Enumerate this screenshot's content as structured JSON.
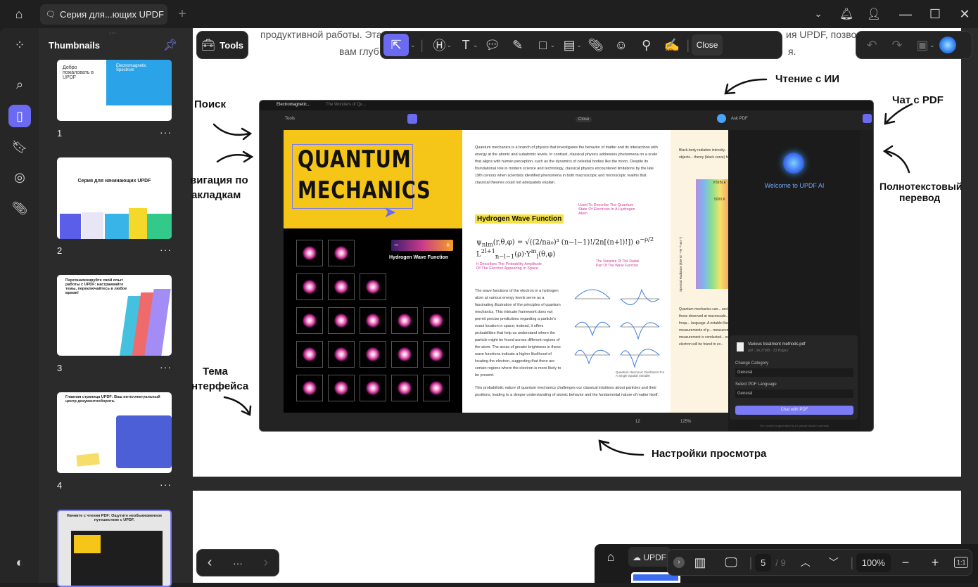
{
  "window": {
    "tab_title": "Серия для...ющих UPDF",
    "new_tab": "+"
  },
  "window_controls": [
    "chevron-down",
    "bell",
    "user",
    "minimize",
    "maximize",
    "close"
  ],
  "rail": {
    "items": [
      "thumbnails-grid",
      "search",
      "pages",
      "bookmarks",
      "ai-chat",
      "attachments"
    ],
    "bottom": "theme"
  },
  "thumbnails": {
    "title": "Thumbnails",
    "pages": [
      {
        "num": "1",
        "heading": "Добро пожаловать в UPDF",
        "sub": "Electromagnetic Spectrum"
      },
      {
        "num": "2",
        "heading": "Серия для начинающих UPDF"
      },
      {
        "num": "3",
        "heading": "Персонализируйте свой опыт работы с UPDF: настраивайте темы, переключайтесь в любое время!"
      },
      {
        "num": "4",
        "heading": "Главная страница UPDF: Ваш интеллектуальный центр документооборота."
      },
      {
        "num": "5",
        "heading": "Начните с чтения PDF: Ощутите необыкновенное путешествие с UPDF."
      }
    ],
    "more": "···"
  },
  "toolbar": {
    "tools_label": "Tools",
    "close_label": "Close"
  },
  "page_text": {
    "line1a": "продуктивной работы. Эта",
    "line1b": "ия UPDF, позво",
    "line2a": "вам глуб",
    "line2b": "я."
  },
  "annotations": {
    "ai_reading": "Чтение с ИИ",
    "chat_pdf": "Чат с PDF",
    "search": "Поиск",
    "nav1": "вигация по",
    "nav2": "акладкам",
    "translate1": "Полнотекстовый",
    "translate2": "перевод",
    "theme1": "Тема",
    "theme2": "нтерфейса",
    "view_settings": "Настройки просмотра"
  },
  "shot": {
    "tab1": "Electromagnetic...",
    "tab2": "The Wonders of Qu...",
    "tools": "Tools",
    "close": "Close",
    "ask_pdf": "Ask PDF",
    "title1": "QUANTUM",
    "title2": "MECHANICS",
    "hwf": "Hydrogen Wave Function",
    "hwf_heading": "Hydrogen Wave Function",
    "note1": "Used To Describe The Quantum State Of Electrons In A Hydrogen Atom",
    "note2": "It Describes The Probability Amplitude Of The Electron Appearing In Space",
    "note3": "The Variation Of The Radial Part Of The Wave Function",
    "para1": "Quantum mechanics is a branch of physics that investigates the behavior of matter and its interactions with energy at the atomic and subatomic levels. In contrast, classical physics addresses phenomena on a scale that aligns with human perception, such as the dynamics of celestial bodies like the moon. Despite its foundational role in modern science and technology, classical physics encountered limitations by the late 19th century when scientists identified phenomena in both macroscopic and microscopic realms that classical theories could not adequately explain.",
    "para2": "The wave functions of the electron in a hydrogen atom at various energy levels serve as a fascinating illustration of the principles of quantum mechanics. This intricate framework does not permit precise predictions regarding a particle's exact location in space; instead, it offers probabilities that help us understand where the particle might be found across different regions of the atom. The areas of greater brightness in these wave functions indicate a higher likelihood of locating the electron, suggesting that there are certain regions where the electron is more likely to be present.",
    "para3": "This probabilistic nature of quantum mechanics challenges our classical intuitions about particles and their positions, leading to a deeper understanding of atomic behavior and the fundamental nature of matter itself.",
    "caption": "Quantum Harmonic Oscillators For A Single Spatial Variable",
    "right_text": "Black-body radiation intensity... visible light, with 5000 K objects... theory (black curve) fails to...",
    "right_text2": "Quantum mechanics can... and may appear paradoxical... those observed at macroscale... stated... quantum mechanics frequ... language. A notable illustration... precise measurements of p... measurements of momentum... measurement is conducted... exhibit 'up' spin, it will then... electron will be found to ex...",
    "chart_label": "VISIBLE",
    "chart_5000": "5000 K",
    "ylabel": "Spectral Radiance (kW·Sr⁻¹·M⁻²·nm⁻¹)",
    "ai_welcome": "Welcome to UPDF AI",
    "file_name": "Various treatment methods.pdf",
    "file_meta": "pdf · 34.27MB · 23 Pages",
    "cat_label": "Change Category",
    "cat_value": "General",
    "lang_label": "Select PDF Language",
    "lang_value": "General",
    "chat_btn": "Chat with PDF",
    "disclaimer": "The content is generated by AI; please discern carefully.",
    "page_num": "12",
    "zoom": "125%"
  },
  "bottom_nav": {
    "prev": "‹",
    "more": "···",
    "next": "›"
  },
  "viewbar": {
    "page": "5",
    "total": "/ 9",
    "zoom": "100%",
    "fit": "1:1",
    "updf_tab": "UPDF"
  }
}
